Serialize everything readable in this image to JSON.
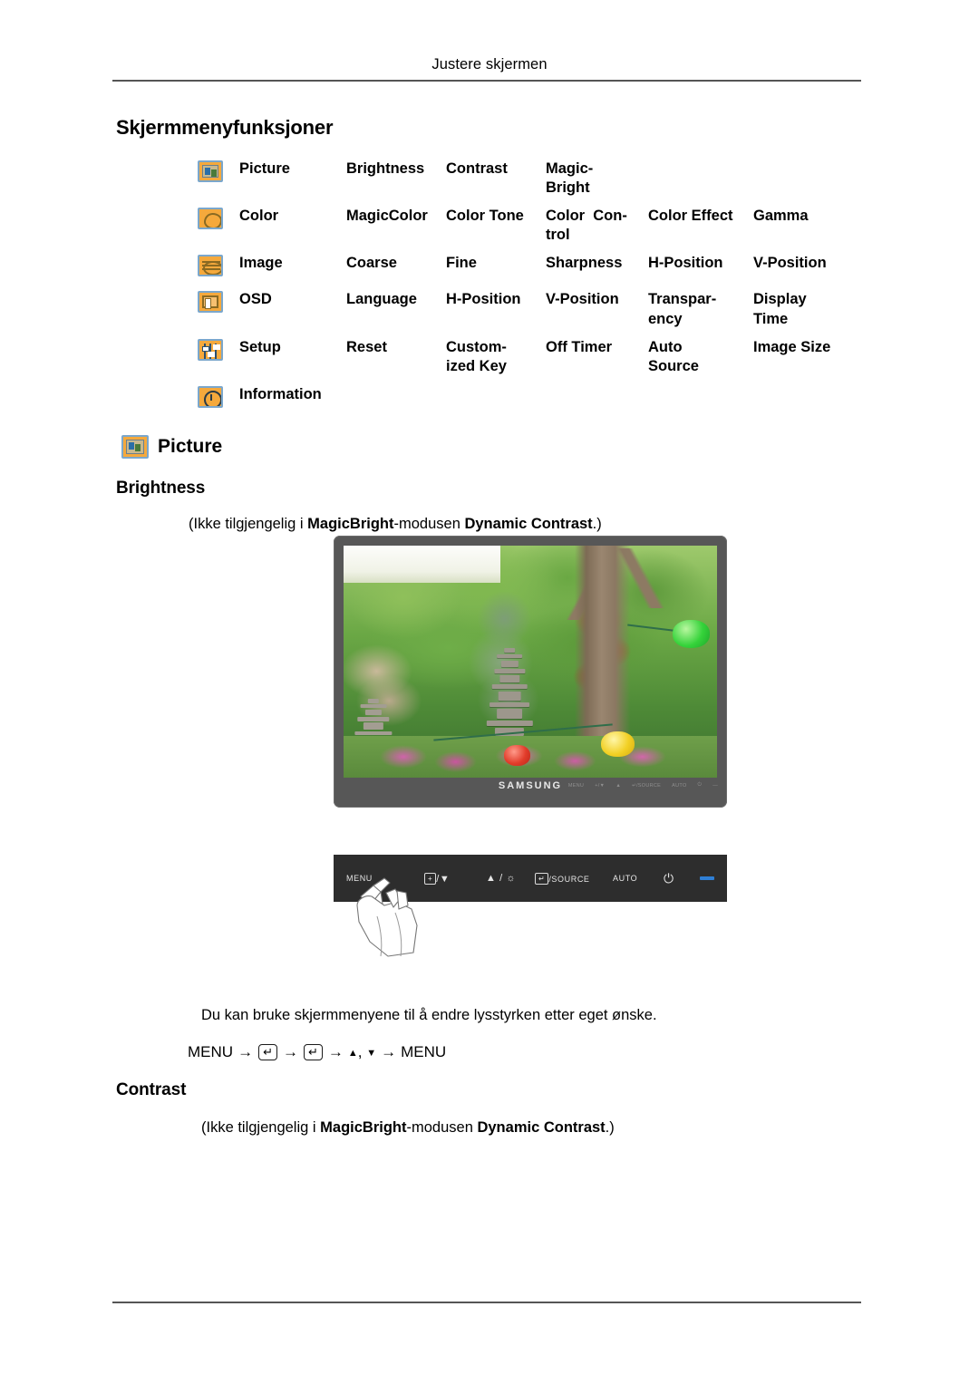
{
  "page": {
    "running_header": "Justere skjermen",
    "section_title": "Skjermmenyfunksjoner"
  },
  "osd_table": {
    "rows": [
      {
        "icon": "picture-frame-icon",
        "category": "Picture",
        "items": [
          "Brightness",
          "Contrast",
          "Magic-\nBright",
          "",
          ""
        ]
      },
      {
        "icon": "color-palette-icon",
        "category": "Color",
        "items": [
          "MagicColor",
          "Color Tone",
          "Color  Con-\ntrol",
          "Color Effect",
          "Gamma"
        ]
      },
      {
        "icon": "image-icon",
        "category": "Image",
        "items": [
          "Coarse",
          "Fine",
          "Sharpness",
          "H-Position",
          "V-Position"
        ]
      },
      {
        "icon": "osd-panel-icon",
        "category": "OSD",
        "items": [
          "Language",
          "H-Position",
          "V-Position",
          "Transpar-\nency",
          "Display\nTime"
        ]
      },
      {
        "icon": "sliders-icon",
        "category": "Setup",
        "items": [
          "Reset",
          "Custom-\nized Key",
          "Off Timer",
          "Auto\nSource",
          "Image Size"
        ]
      },
      {
        "icon": "information-clock-icon",
        "category": "Information",
        "items": [
          "",
          "",
          "",
          "",
          ""
        ]
      }
    ]
  },
  "picture_section": {
    "icon": "picture-frame-icon",
    "heading": "Picture"
  },
  "brightness_section": {
    "heading": "Brightness",
    "note_prefix": "(Ikke tilgjengelig i ",
    "note_bold1": "MagicBright",
    "note_mid": "-modusen ",
    "note_bold2": "Dynamic Contrast",
    "note_suffix": ".)",
    "description": "Du kan bruke skjermmenyene til å endre lysstyrken etter eget ønske.",
    "sequence": {
      "start": "MENU",
      "key1": "↵",
      "key2": "↵",
      "up": "▲",
      "comma": ",",
      "down": "▼",
      "end": "MENU",
      "arrow": "→"
    }
  },
  "contrast_section": {
    "heading": "Contrast",
    "note_prefix": "(Ikke tilgjengelig i ",
    "note_bold1": "MagicBright",
    "note_mid": "-modusen ",
    "note_bold2": "Dynamic Contrast",
    "note_suffix": ".)"
  },
  "monitor": {
    "brand": "SAMSUNG",
    "bezel_keys": [
      "MENU",
      "+/▼",
      "▲",
      "↵/SOURCE",
      "AUTO",
      "⏻",
      "—"
    ]
  },
  "control_panel": {
    "menu_label": "MENU",
    "down_label": "/▼",
    "down_key": "+",
    "up_label": "▲ / ☼",
    "source_key": "↵",
    "source_label": "/SOURCE",
    "auto_label": "AUTO",
    "power_label": "⏻",
    "indicator_color": "#2f7fd6"
  }
}
